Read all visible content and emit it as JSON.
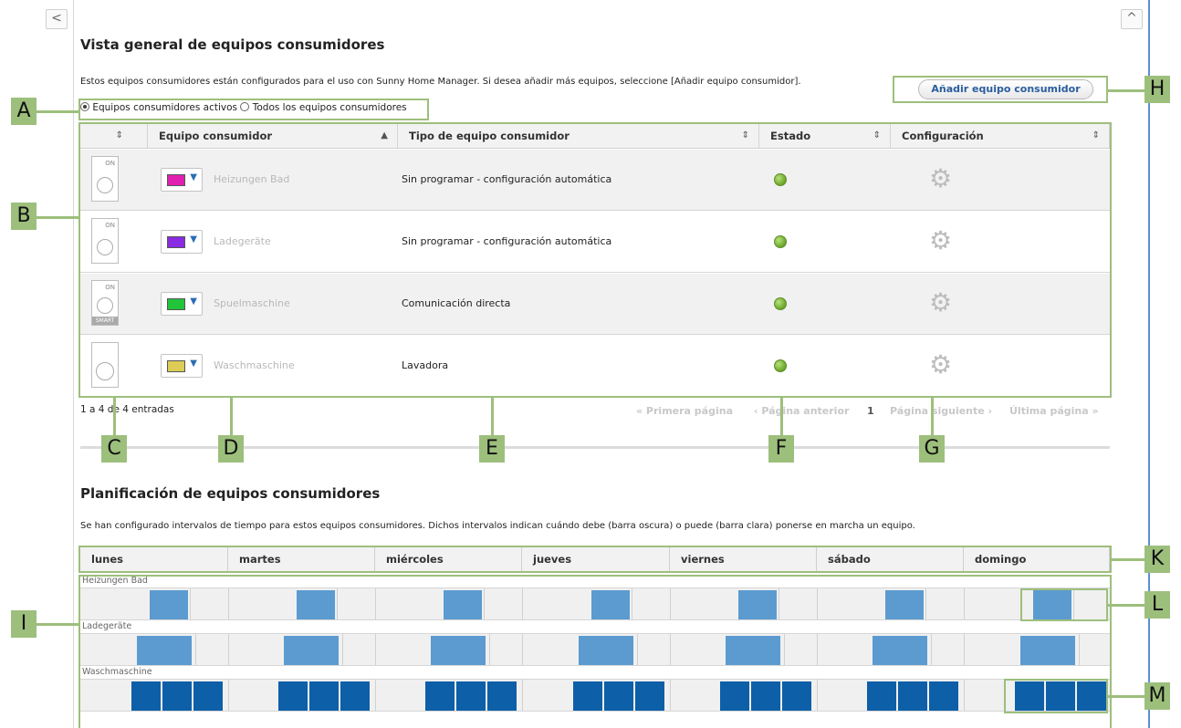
{
  "nav": {
    "left_label": "<",
    "up_label": "^"
  },
  "overview": {
    "title": "Vista general de equipos consumidores",
    "description": "Estos equipos consumidores están configurados para el uso con Sunny Home Manager. Si desea añadir más equipos, seleccione [Añadir equipo consumidor].",
    "add_button": "Añadir equipo consumidor",
    "filter_active": "Equipos consumidores activos",
    "filter_all": "Todos los equipos consumidores",
    "columns": {
      "icon": "",
      "device": "Equipo consumidor",
      "type": "Tipo de equipo consumidor",
      "status": "Estado",
      "config": "Configuración"
    },
    "rows": [
      {
        "name": "Heizungen Bad",
        "type": "Sin programar - configuración automática",
        "color": "#e020b0",
        "icon_on": "ON",
        "smart": ""
      },
      {
        "name": "Ladegeräte",
        "type": "Sin programar - configuración automática",
        "color": "#8a2be2",
        "icon_on": "ON",
        "smart": ""
      },
      {
        "name": "Spuelmaschine",
        "type": "Comunicación directa",
        "color": "#22c43a",
        "icon_on": "ON",
        "smart": "SMART"
      },
      {
        "name": "Waschmaschine",
        "type": "Lavadora",
        "color": "#ddcc55",
        "icon_on": "",
        "smart": ""
      }
    ],
    "entries": "1 a 4 de 4 entradas",
    "pager": {
      "first": "« Primera página",
      "prev": "‹ Página anterior",
      "page": "1",
      "next": "Página siguiente ›",
      "last": "Última página »"
    }
  },
  "planning": {
    "title": "Planificación de equipos consumidores",
    "description": "Se han configurado intervalos de tiempo para estos equipos consumidores. Dichos intervalos indican cuándo debe (barra oscura) o puede (barra clara) ponerse en marcha un equipo.",
    "days": [
      "lunes",
      "martes",
      "miércoles",
      "jueves",
      "viernes",
      "sábado",
      "domingo"
    ],
    "lanes": [
      {
        "label": "Heizungen Bad"
      },
      {
        "label": "Ladegeräte"
      },
      {
        "label": "Waschmaschine"
      }
    ]
  },
  "callouts": [
    "A",
    "B",
    "C",
    "D",
    "E",
    "F",
    "G",
    "H",
    "I",
    "K",
    "L",
    "M"
  ],
  "colors": {
    "callout": "#9dbf7c",
    "light_bar": "#5b9bd0",
    "dark_bar": "#0d5fa8",
    "link": "#2a5d9f"
  }
}
